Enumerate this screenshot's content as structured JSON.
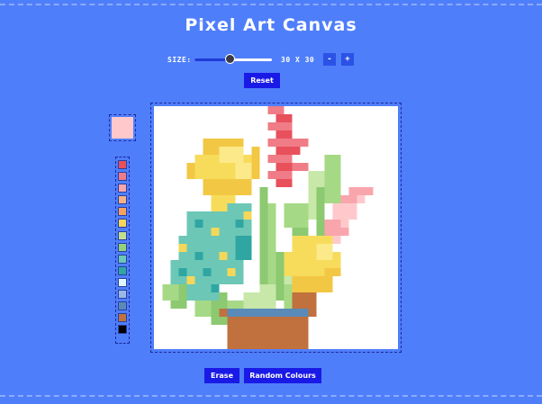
{
  "app": {
    "title": "Pixel Art Canvas"
  },
  "size_control": {
    "label": "SIZE:",
    "value_text": "30 X 30",
    "slider_value": 30,
    "slider_min": 2,
    "slider_max": 64,
    "minus_label": "-",
    "plus_label": "+"
  },
  "buttons": {
    "reset": "Reset",
    "erase": "Erase",
    "random": "Random Colours"
  },
  "current_color": "#ffc9cc",
  "palette": [
    "#e8505b",
    "#f07c87",
    "#f9a5ac",
    "#f5b183",
    "#f5a25f",
    "#f5d75a",
    "#c2e08e",
    "#95d178",
    "#6cc7b6",
    "#2fa6a2",
    "#dff5ff",
    "#9ab8e6",
    "#5a8ab8",
    "#c0713e",
    "#000000"
  ],
  "colors": {
    "background": "#4f7efa",
    "button": "#1a1ae6",
    "canvas_bg": "#ffffff",
    "accent_dark": "#1a2aa0"
  },
  "icons": {
    "minus": "minus-icon",
    "plus": "plus-icon"
  }
}
